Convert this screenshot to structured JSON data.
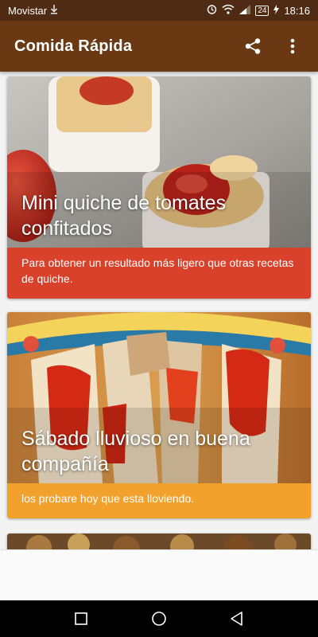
{
  "status_bar": {
    "carrier": "Movistar",
    "battery": "24",
    "time": "18:16"
  },
  "app_bar": {
    "title": "Comida Rápida"
  },
  "cards": [
    {
      "title": "Mini quiche de tomates confitados",
      "description": "Para obtener un resultado más ligero que otras recetas de quiche.",
      "color": "#d9412b"
    },
    {
      "title": "Sábado lluvioso en buena compañía",
      "description": "los probare hoy que esta lloviendo.",
      "color": "#f1a12c"
    }
  ],
  "colors": {
    "status_bar": "#4f2b13",
    "app_bar": "#6a3914"
  }
}
